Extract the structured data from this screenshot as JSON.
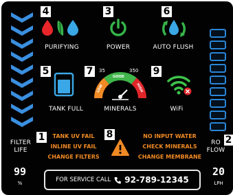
{
  "indicators": {
    "purifying": {
      "number": "4",
      "label": "PURIFYING"
    },
    "power": {
      "number": "3",
      "label": "POWER"
    },
    "auto_flush": {
      "number": "6",
      "label": "AUTO FLUSH"
    },
    "tank_full": {
      "number": "5",
      "label": "TANK FULL"
    },
    "minerals": {
      "number": "7",
      "label": "MINERALS",
      "scale_min": "35",
      "scale_max": "350",
      "zones": [
        "LOW",
        "GOOD",
        "HIGH"
      ]
    },
    "wifi": {
      "number": "9",
      "label": "WiFi"
    },
    "warnings": {
      "number": "8"
    }
  },
  "filter_life": {
    "number": "1",
    "label_line1": "FILTER",
    "label_line2": "LIFE",
    "value": "99",
    "unit": "%"
  },
  "ro_flow": {
    "number": "2",
    "label_line1": "RO",
    "label_line2": "FLOW",
    "value": "20",
    "unit": "LPH"
  },
  "warnings_left": [
    "TANK UV FAIL",
    "INLINE UV FAIL",
    "CHANGE FILTERS"
  ],
  "warnings_right": [
    "NO INPUT WATER",
    "CHECK MINERALS",
    "CHANGE MEMBRANE"
  ],
  "service": {
    "text": "FOR SERVICE CALL",
    "phone": "92-789-12345",
    "phone_icon": "phone-icon"
  },
  "colors": {
    "background": "#020202",
    "chevron_blue": "#3a8fe0",
    "drop_red": "#e8262a",
    "drop_blue": "#3aa7e6",
    "leaf_green": "#34b24a",
    "power_green": "#35b34a",
    "warning_orange": "#f08a24",
    "wifi_green": "#3ec24a",
    "wifi_error_red": "#e0262a",
    "ro_bar_blue": "#2a86d8"
  }
}
